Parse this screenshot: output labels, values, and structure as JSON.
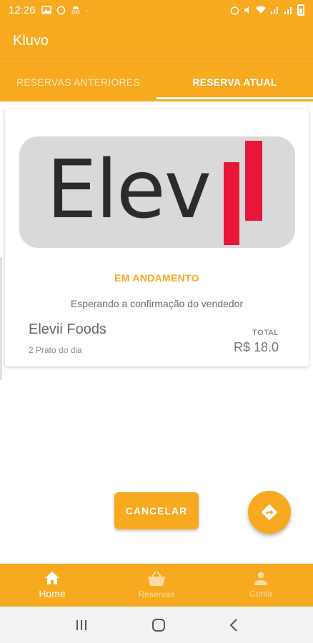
{
  "status_bar": {
    "time": "12:26"
  },
  "app_bar": {
    "title": "Kluvo"
  },
  "tabs": [
    {
      "label": "RESERVAS ANTERIORES"
    },
    {
      "label": "RESERVA ATUAL"
    }
  ],
  "reservation": {
    "logo_text": "Elev",
    "status": "EM ANDAMENTO",
    "message": "Esperando a confirmação do vendedor",
    "store_name": "Elevii Foods",
    "items": "2 Prato do dia",
    "total_label": "TOTAL",
    "total_value": "R$ 18.0"
  },
  "actions": {
    "cancel_label": "CANCELAR"
  },
  "bottom_nav": [
    {
      "label": "Home",
      "icon": "home-icon"
    },
    {
      "label": "Reservas",
      "icon": "basket-icon"
    },
    {
      "label": "Conta",
      "icon": "person-icon"
    }
  ],
  "colors": {
    "accent": "#f7a91f",
    "logo_red": "#e8173a"
  }
}
